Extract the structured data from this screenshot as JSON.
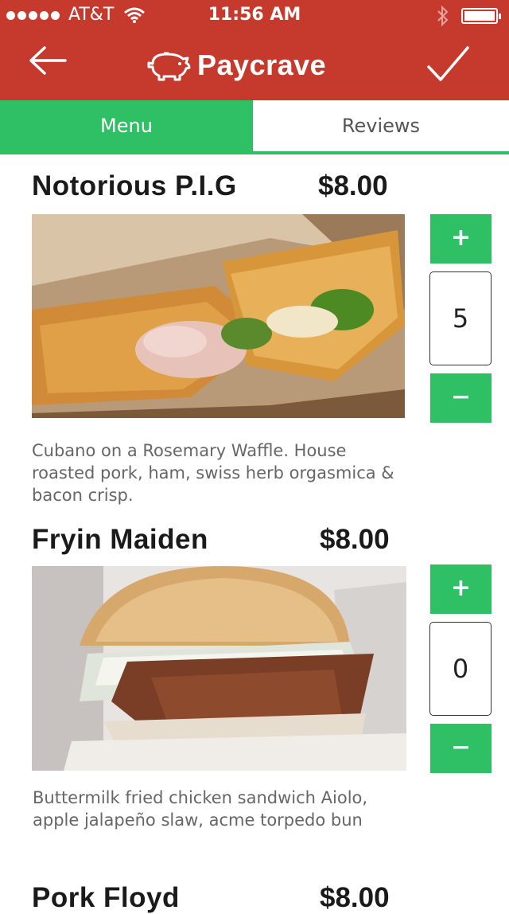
{
  "status_bar": {
    "carrier": "AT&T",
    "time": "11:56 AM"
  },
  "header": {
    "brand": "Paycrave",
    "back_icon": "arrow-left-icon",
    "confirm_icon": "checkmark-icon",
    "logo_icon": "pig-icon"
  },
  "tabs": [
    {
      "label": "Menu",
      "active": true
    },
    {
      "label": "Reviews",
      "active": false
    }
  ],
  "colors": {
    "header": "#c63a2e",
    "accent_green": "#2fc066"
  },
  "menu_items": [
    {
      "name": "Notorious P.I.G",
      "price": "$8.00",
      "description": "Cubano on a Rosemary Waffle. House roasted pork, ham, swiss herb orgasmica & bacon crisp.",
      "quantity": "5",
      "increment_label": "+",
      "decrement_label": "−"
    },
    {
      "name": "Fryin Maiden",
      "price": "$8.00",
      "description": "Buttermilk fried chicken sandwich Aiolo, apple jalapeño slaw, acme torpedo bun",
      "quantity": "0",
      "increment_label": "+",
      "decrement_label": "−"
    },
    {
      "name": "Pork Floyd",
      "price": "$8.00"
    }
  ]
}
